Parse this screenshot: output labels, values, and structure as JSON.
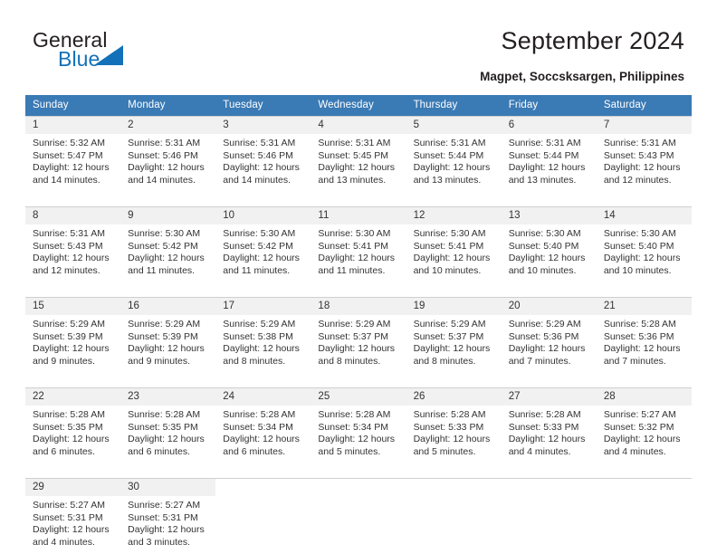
{
  "brand": {
    "name_top": "General",
    "name_bottom": "Blue",
    "logo_icon": "triangle-icon",
    "accent_color": "#1271b8",
    "text_color": "#231f20"
  },
  "header": {
    "title": "September 2024",
    "subtitle": "Magpet, Soccsksargen, Philippines"
  },
  "calendar": {
    "header_bg": "#3a7ab5",
    "header_text_color": "#ffffff",
    "daynum_bg": "#f1f1f1",
    "grid_line_color": "#cfcfcf",
    "weekday_headers": [
      "Sunday",
      "Monday",
      "Tuesday",
      "Wednesday",
      "Thursday",
      "Friday",
      "Saturday"
    ],
    "labels": {
      "sunrise": "Sunrise:",
      "sunset": "Sunset:",
      "daylight": "Daylight:"
    },
    "weeks": [
      [
        {
          "day": "1",
          "sunrise": "Sunrise: 5:32 AM",
          "sunset": "Sunset: 5:47 PM",
          "daylight_1": "Daylight: 12 hours",
          "daylight_2": "and 14 minutes."
        },
        {
          "day": "2",
          "sunrise": "Sunrise: 5:31 AM",
          "sunset": "Sunset: 5:46 PM",
          "daylight_1": "Daylight: 12 hours",
          "daylight_2": "and 14 minutes."
        },
        {
          "day": "3",
          "sunrise": "Sunrise: 5:31 AM",
          "sunset": "Sunset: 5:46 PM",
          "daylight_1": "Daylight: 12 hours",
          "daylight_2": "and 14 minutes."
        },
        {
          "day": "4",
          "sunrise": "Sunrise: 5:31 AM",
          "sunset": "Sunset: 5:45 PM",
          "daylight_1": "Daylight: 12 hours",
          "daylight_2": "and 13 minutes."
        },
        {
          "day": "5",
          "sunrise": "Sunrise: 5:31 AM",
          "sunset": "Sunset: 5:44 PM",
          "daylight_1": "Daylight: 12 hours",
          "daylight_2": "and 13 minutes."
        },
        {
          "day": "6",
          "sunrise": "Sunrise: 5:31 AM",
          "sunset": "Sunset: 5:44 PM",
          "daylight_1": "Daylight: 12 hours",
          "daylight_2": "and 13 minutes."
        },
        {
          "day": "7",
          "sunrise": "Sunrise: 5:31 AM",
          "sunset": "Sunset: 5:43 PM",
          "daylight_1": "Daylight: 12 hours",
          "daylight_2": "and 12 minutes."
        }
      ],
      [
        {
          "day": "8",
          "sunrise": "Sunrise: 5:31 AM",
          "sunset": "Sunset: 5:43 PM",
          "daylight_1": "Daylight: 12 hours",
          "daylight_2": "and 12 minutes."
        },
        {
          "day": "9",
          "sunrise": "Sunrise: 5:30 AM",
          "sunset": "Sunset: 5:42 PM",
          "daylight_1": "Daylight: 12 hours",
          "daylight_2": "and 11 minutes."
        },
        {
          "day": "10",
          "sunrise": "Sunrise: 5:30 AM",
          "sunset": "Sunset: 5:42 PM",
          "daylight_1": "Daylight: 12 hours",
          "daylight_2": "and 11 minutes."
        },
        {
          "day": "11",
          "sunrise": "Sunrise: 5:30 AM",
          "sunset": "Sunset: 5:41 PM",
          "daylight_1": "Daylight: 12 hours",
          "daylight_2": "and 11 minutes."
        },
        {
          "day": "12",
          "sunrise": "Sunrise: 5:30 AM",
          "sunset": "Sunset: 5:41 PM",
          "daylight_1": "Daylight: 12 hours",
          "daylight_2": "and 10 minutes."
        },
        {
          "day": "13",
          "sunrise": "Sunrise: 5:30 AM",
          "sunset": "Sunset: 5:40 PM",
          "daylight_1": "Daylight: 12 hours",
          "daylight_2": "and 10 minutes."
        },
        {
          "day": "14",
          "sunrise": "Sunrise: 5:30 AM",
          "sunset": "Sunset: 5:40 PM",
          "daylight_1": "Daylight: 12 hours",
          "daylight_2": "and 10 minutes."
        }
      ],
      [
        {
          "day": "15",
          "sunrise": "Sunrise: 5:29 AM",
          "sunset": "Sunset: 5:39 PM",
          "daylight_1": "Daylight: 12 hours",
          "daylight_2": "and 9 minutes."
        },
        {
          "day": "16",
          "sunrise": "Sunrise: 5:29 AM",
          "sunset": "Sunset: 5:39 PM",
          "daylight_1": "Daylight: 12 hours",
          "daylight_2": "and 9 minutes."
        },
        {
          "day": "17",
          "sunrise": "Sunrise: 5:29 AM",
          "sunset": "Sunset: 5:38 PM",
          "daylight_1": "Daylight: 12 hours",
          "daylight_2": "and 8 minutes."
        },
        {
          "day": "18",
          "sunrise": "Sunrise: 5:29 AM",
          "sunset": "Sunset: 5:37 PM",
          "daylight_1": "Daylight: 12 hours",
          "daylight_2": "and 8 minutes."
        },
        {
          "day": "19",
          "sunrise": "Sunrise: 5:29 AM",
          "sunset": "Sunset: 5:37 PM",
          "daylight_1": "Daylight: 12 hours",
          "daylight_2": "and 8 minutes."
        },
        {
          "day": "20",
          "sunrise": "Sunrise: 5:29 AM",
          "sunset": "Sunset: 5:36 PM",
          "daylight_1": "Daylight: 12 hours",
          "daylight_2": "and 7 minutes."
        },
        {
          "day": "21",
          "sunrise": "Sunrise: 5:28 AM",
          "sunset": "Sunset: 5:36 PM",
          "daylight_1": "Daylight: 12 hours",
          "daylight_2": "and 7 minutes."
        }
      ],
      [
        {
          "day": "22",
          "sunrise": "Sunrise: 5:28 AM",
          "sunset": "Sunset: 5:35 PM",
          "daylight_1": "Daylight: 12 hours",
          "daylight_2": "and 6 minutes."
        },
        {
          "day": "23",
          "sunrise": "Sunrise: 5:28 AM",
          "sunset": "Sunset: 5:35 PM",
          "daylight_1": "Daylight: 12 hours",
          "daylight_2": "and 6 minutes."
        },
        {
          "day": "24",
          "sunrise": "Sunrise: 5:28 AM",
          "sunset": "Sunset: 5:34 PM",
          "daylight_1": "Daylight: 12 hours",
          "daylight_2": "and 6 minutes."
        },
        {
          "day": "25",
          "sunrise": "Sunrise: 5:28 AM",
          "sunset": "Sunset: 5:34 PM",
          "daylight_1": "Daylight: 12 hours",
          "daylight_2": "and 5 minutes."
        },
        {
          "day": "26",
          "sunrise": "Sunrise: 5:28 AM",
          "sunset": "Sunset: 5:33 PM",
          "daylight_1": "Daylight: 12 hours",
          "daylight_2": "and 5 minutes."
        },
        {
          "day": "27",
          "sunrise": "Sunrise: 5:28 AM",
          "sunset": "Sunset: 5:33 PM",
          "daylight_1": "Daylight: 12 hours",
          "daylight_2": "and 4 minutes."
        },
        {
          "day": "28",
          "sunrise": "Sunrise: 5:27 AM",
          "sunset": "Sunset: 5:32 PM",
          "daylight_1": "Daylight: 12 hours",
          "daylight_2": "and 4 minutes."
        }
      ],
      [
        {
          "day": "29",
          "sunrise": "Sunrise: 5:27 AM",
          "sunset": "Sunset: 5:31 PM",
          "daylight_1": "Daylight: 12 hours",
          "daylight_2": "and 4 minutes."
        },
        {
          "day": "30",
          "sunrise": "Sunrise: 5:27 AM",
          "sunset": "Sunset: 5:31 PM",
          "daylight_1": "Daylight: 12 hours",
          "daylight_2": "and 3 minutes."
        },
        {
          "day": "",
          "sunrise": "",
          "sunset": "",
          "daylight_1": "",
          "daylight_2": ""
        },
        {
          "day": "",
          "sunrise": "",
          "sunset": "",
          "daylight_1": "",
          "daylight_2": ""
        },
        {
          "day": "",
          "sunrise": "",
          "sunset": "",
          "daylight_1": "",
          "daylight_2": ""
        },
        {
          "day": "",
          "sunrise": "",
          "sunset": "",
          "daylight_1": "",
          "daylight_2": ""
        },
        {
          "day": "",
          "sunrise": "",
          "sunset": "",
          "daylight_1": "",
          "daylight_2": ""
        }
      ]
    ]
  }
}
